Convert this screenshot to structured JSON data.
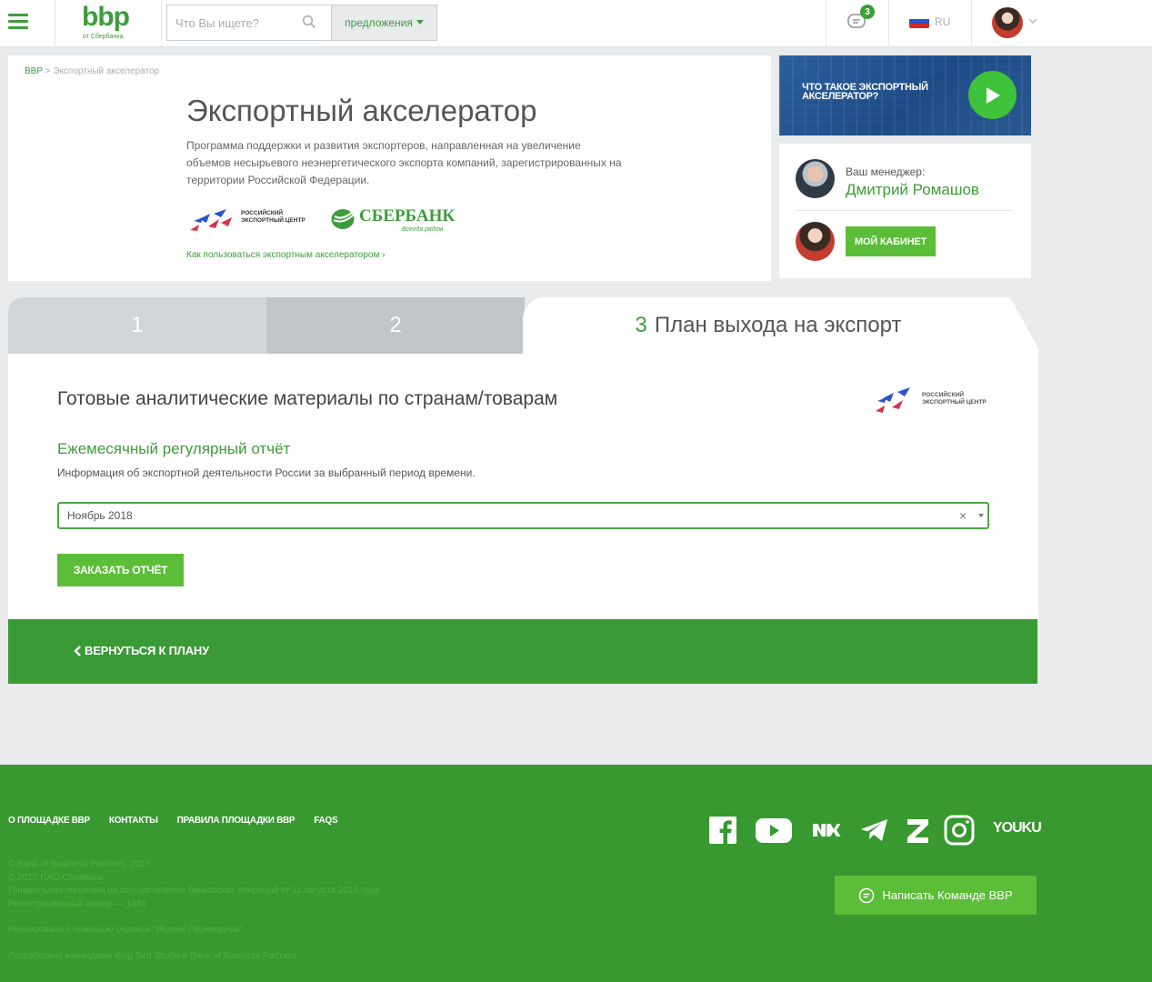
{
  "header": {
    "logo_text": "bbp",
    "logo_sub": "от Сбербанка",
    "search_placeholder": "Что Вы ищете?",
    "offers_label": "предложения",
    "messages_count": "3",
    "language": "RU",
    "flag_colors": [
      "#ffffff",
      "#2b54c9",
      "#d62828"
    ],
    "accent_color": "#3d9d3a"
  },
  "breadcrumb": {
    "root": "BBP",
    "separator": ">",
    "current": "Экспортный акселератор"
  },
  "hero": {
    "title": "Экспортный акселератор",
    "description": "Программа поддержки и развития экспортеров, направленная на увеличение объемов несырьевого неэнергетического экспорта компаний, зарегистрированных на территории Российской Федерации.",
    "rec_name": "РОССИЙСКИЙ ЭКСПОРТНЫЙ ЦЕНТР",
    "sber_name": "СБЕРБАНК",
    "sber_tagline": "Всегда рядом",
    "howto_link": "Как пользоваться экспортным акселератором"
  },
  "video": {
    "title": "Что такое экспортный акселератор?",
    "icon": "play-icon"
  },
  "manager": {
    "label": "Ваш менеджер:",
    "name": "Дмитрий Ромашов",
    "cabinet_button": "Мой кабинет"
  },
  "steps": [
    {
      "number": "1",
      "label": ""
    },
    {
      "number": "2",
      "label": ""
    },
    {
      "number": "3",
      "label": "План выхода на экспорт"
    }
  ],
  "main": {
    "title": "Готовые аналитические материалы по странам/товарам",
    "report_title": "Ежемесячный регулярный отчёт",
    "report_desc": "Информация об экспортной деятельности России за выбранный период времени.",
    "period_value": "Ноябрь 2018",
    "order_button": "Заказать отчёт",
    "back_link": "Вернуться к плану"
  },
  "footer": {
    "nav": [
      "О площадке BBP",
      "Контакты",
      "Правила площадки BBP",
      "FAQs"
    ],
    "legal": [
      "© Bank of Business Partners, 2017",
      "© 2017 ПАО Сбербанк",
      "Генеральная лицензия на осуществление банковских операций от 11 августа 2015 года",
      "Регистрационный номер — 1481"
    ],
    "notes": [
      "Реализовано с помощью сервиса \"Яндекс.Переводчик\"",
      "Разработано командами King Bird Studio и Bank of Business Partners"
    ],
    "socials": [
      "facebook-icon",
      "youtube-icon",
      "vk-icon",
      "telegram-icon",
      "zen-icon",
      "instagram-icon"
    ],
    "youku_label": "YOUKU",
    "write_button": "Написать Команде BBP"
  }
}
